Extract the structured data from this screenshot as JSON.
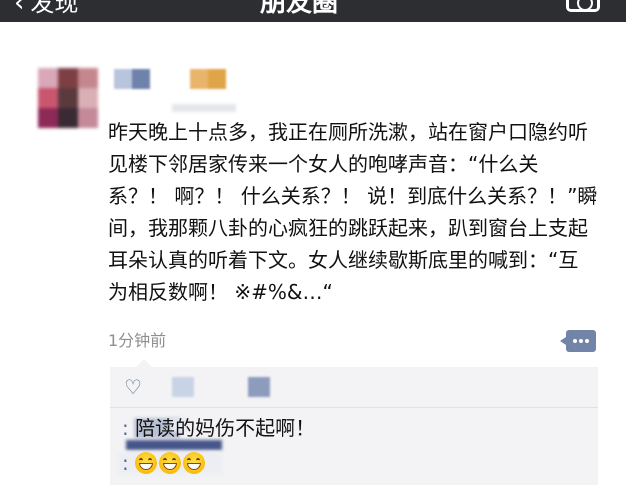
{
  "header": {
    "back_label": "发现",
    "title": "朋友圈"
  },
  "colors": {
    "header_bg": "#2d2e32",
    "link_blue": "#586b95",
    "meta_gray": "#8f8f8f",
    "comment_bg": "#f3f3f5"
  },
  "post": {
    "text": "昨天晚上十点多，我正在厕所洗漱，站在窗户口隐约听见楼下邻居家传来一个女人的咆哮声音：“什么关系？！ 啊？！ 什么关系？！ 说！到底什么关系？！”瞬间，我那颗八卦的心疯狂的跳跃起来，趴到窗台上支起耳朵认真的听着下文。女人继续歇斯底里的喊到：“互为相反数啊！ ※#%&…“",
    "time": "1分钟前",
    "action_icon": "comment-action-icon"
  },
  "likes": {
    "icon": "heart-icon"
  },
  "comments": [
    {
      "sep": ":",
      "text": "陪读的妈伤不起啊！"
    },
    {
      "sep": ":",
      "emoji_count": 3,
      "emoji_icon": "grinning-face-emoji"
    }
  ]
}
